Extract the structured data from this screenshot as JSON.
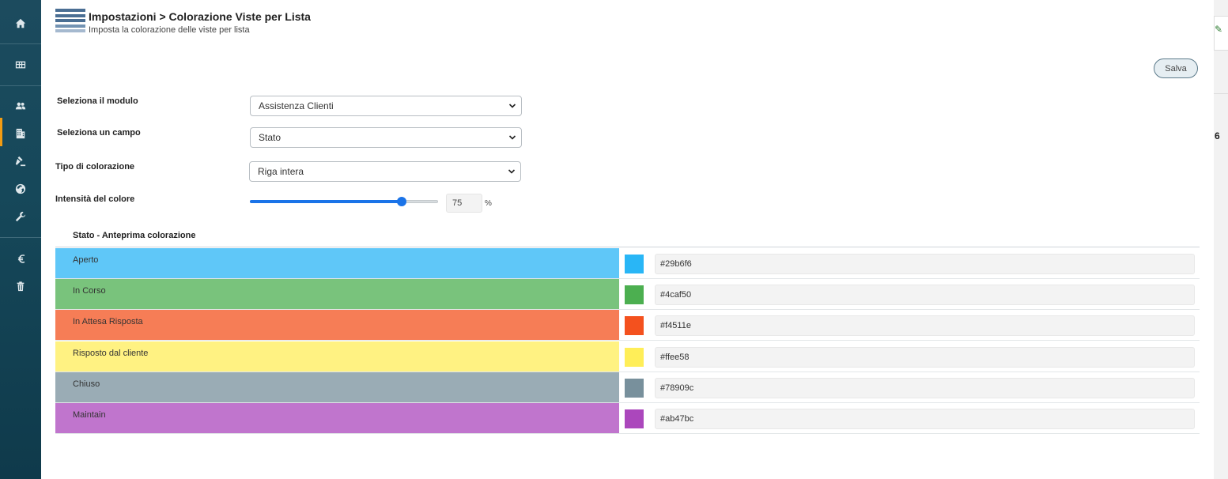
{
  "sidebar": {
    "items": [
      {
        "icon": "home-icon"
      },
      {
        "icon": "grid-icon"
      },
      {
        "icon": "users-icon"
      },
      {
        "icon": "building-icon",
        "active": true
      },
      {
        "icon": "gavel-icon"
      },
      {
        "icon": "globe-icon"
      },
      {
        "icon": "wrench-icon"
      },
      {
        "icon": "euro-icon"
      },
      {
        "icon": "trash-icon"
      }
    ]
  },
  "header": {
    "title": "Impostazioni > Colorazione Viste per Lista",
    "subtitle": "Imposta la colorazione delle viste per lista"
  },
  "toolbar": {
    "save_label": "Salva"
  },
  "form": {
    "module_label": "Seleziona il modulo",
    "module_value": "Assistenza Clienti",
    "field_label": "Seleziona un campo",
    "field_value": "Stato",
    "coloring_label": "Tipo di colorazione",
    "coloring_value": "Riga intera",
    "intensity_label": "Intensità del colore",
    "intensity_value": "75",
    "intensity_unit": "%",
    "intensity_fraction": 0.75
  },
  "preview": {
    "title": "Stato - Anteprima colorazione",
    "rows": [
      {
        "label": "Aperto",
        "hex": "#29b6f6",
        "color": "#29b6f6",
        "band": "#5fc7f8"
      },
      {
        "label": "In Corso",
        "hex": "#4caf50",
        "color": "#4caf50",
        "band": "#79c37c"
      },
      {
        "label": "In Attesa Risposta",
        "hex": "#f4511e",
        "color": "#f4511e",
        "band": "#f67d56"
      },
      {
        "label": "Risposto dal cliente",
        "hex": "#ffee58",
        "color": "#ffee58",
        "band": "#fff282"
      },
      {
        "label": "Chiuso",
        "hex": "#78909c",
        "color": "#78909c",
        "band": "#9aacb5"
      },
      {
        "label": "Maintain",
        "hex": "#ab47bc",
        "color": "#ab47bc",
        "band": "#c075cd"
      }
    ]
  },
  "right_panel": {
    "number": "6"
  }
}
